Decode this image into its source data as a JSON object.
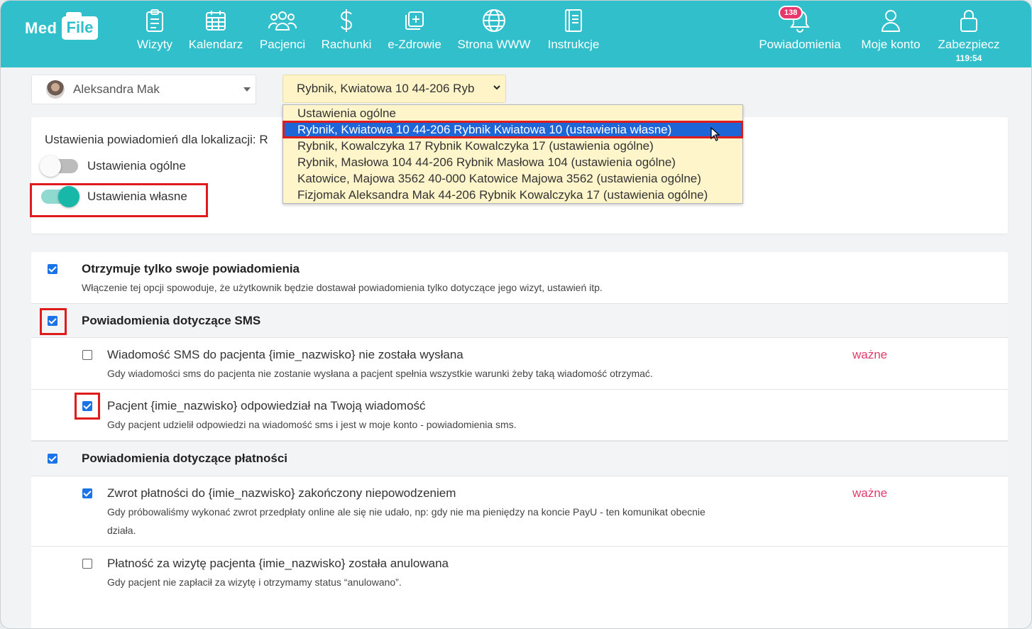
{
  "header": {
    "logo_med": "Med",
    "logo_file": "File",
    "nav": [
      {
        "label": "Wizyty",
        "icon": "clipboard-icon"
      },
      {
        "label": "Kalendarz",
        "icon": "calendar-icon"
      },
      {
        "label": "Pacjenci",
        "icon": "users-icon"
      },
      {
        "label": "Rachunki",
        "icon": "dollar-icon"
      },
      {
        "label": "e-Zdrowie",
        "icon": "medical-cross-icon"
      },
      {
        "label": "Strona WWW",
        "icon": "globe-icon"
      },
      {
        "label": "Instrukcje",
        "icon": "book-icon"
      }
    ],
    "right": {
      "notifications": {
        "label": "Powiadomienia",
        "badge": "138",
        "icon": "bell-icon"
      },
      "account": {
        "label": "Moje konto",
        "icon": "user-icon"
      },
      "secure": {
        "label": "Zabezpiecz",
        "timer": "119:54",
        "icon": "lock-icon"
      }
    }
  },
  "user_select": {
    "value": "Aleksandra Mak"
  },
  "location_select": {
    "value": "Rybnik, Kwiatowa 10 44-206 Ryb",
    "options": [
      "Ustawienia ogólne",
      "Rybnik, Kwiatowa 10 44-206 Rybnik Kwiatowa 10 (ustawienia własne)",
      "Rybnik, Kowalczyka 17 Rybnik Kowalczyka 17 (ustawienia ogólne)",
      "Rybnik, Masłowa 104 44-206 Rybnik Masłowa 104 (ustawienia ogólne)",
      "Katowice, Majowa 3562 40-000 Katowice Majowa 3562 (ustawienia ogólne)",
      "Fizjomak Aleksandra Mak 44-206 Rybnik Kowalczyka 17 (ustawienia ogólne)"
    ],
    "selected_index": 1
  },
  "location_settings": {
    "label": "Ustawienia powiadomień dla lokalizacji: R",
    "toggle_general": {
      "label": "Ustawienia ogólne",
      "on": false
    },
    "toggle_custom": {
      "label": "Ustawienia własne",
      "on": true
    }
  },
  "settings": {
    "own_only": {
      "title": "Otrzymuje tylko swoje powiadomienia",
      "desc": "Włączenie tej opcji spowoduje, że użytkownik będzie dostawał powiadomienia tylko dotyczące jego wizyt, ustawień itp.",
      "checked": true
    },
    "sms_group": {
      "title": "Powiadomienia dotyczące SMS",
      "checked": true
    },
    "sms_items": [
      {
        "title": "Wiadomość SMS do pacjenta {imie_nazwisko} nie została wysłana",
        "desc": "Gdy wiadomości sms do pacjenta nie zostanie wysłana a pacjent spełnia wszystkie warunki żeby taką wiadomość otrzymać.",
        "checked": false,
        "important": "ważne"
      },
      {
        "title": "Pacjent {imie_nazwisko} odpowiedział na Twoją wiadomość",
        "desc": "Gdy pacjent udzielił odpowiedzi na wiadomość sms i jest w moje konto - powiadomienia sms.",
        "checked": true
      }
    ],
    "payment_group": {
      "title": "Powiadomienia dotyczące płatności",
      "checked": true
    },
    "payment_items": [
      {
        "title": "Zwrot płatności do {imie_nazwisko} zakończony niepowodzeniem",
        "desc": "Gdy próbowaliśmy wykonać zwrot przedpłaty online ale się nie udało, np: gdy nie ma pieniędzy na koncie PayU - ten komunikat obecnie działa.",
        "checked": true,
        "important": "ważne"
      },
      {
        "title": "Płatność za wizytę pacjenta {imie_nazwisko} została anulowana",
        "desc": "Gdy pacjent nie zapłacił za wizytę i otrzymamy status “anulowano”.",
        "checked": false
      }
    ]
  }
}
